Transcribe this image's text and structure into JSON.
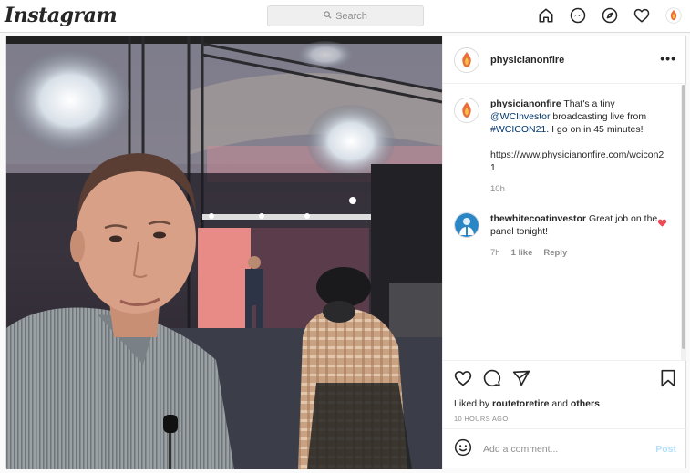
{
  "topbar": {
    "logo": "Instagram",
    "search_placeholder": "Search",
    "icons": [
      "home-icon",
      "messenger-icon",
      "explore-icon",
      "activity-heart-icon",
      "profile-avatar-icon"
    ]
  },
  "post": {
    "username": "physicianonfire",
    "more_label": "•••",
    "caption": {
      "username": "physicianonfire",
      "text_1": " That's a tiny ",
      "mention": "@WCInvestor",
      "text_2": " broadcasting live from ",
      "hashtag": "#WCICON21",
      "text_3": ". I go on in 45 minutes!",
      "url": "https://www.physicianonfire.com/wcicon21",
      "time": "10h"
    },
    "reply": {
      "username": "thewhitecoatinvestor",
      "text": " Great job on the panel tonight!",
      "time": "7h",
      "likes": "1 like",
      "reply_label": "Reply"
    },
    "liked_by_prefix": "Liked by ",
    "liked_by_user": "routetoretire",
    "liked_by_suffix": " and ",
    "liked_by_others": "others",
    "posted_ago": "10 hours ago",
    "add_comment_placeholder": "Add a comment...",
    "post_button": "Post"
  },
  "colors": {
    "accent_link": "#00376b",
    "like_red": "#ed4956",
    "post_button_disabled": "#b2dffc",
    "border": "#dbdbdb"
  }
}
